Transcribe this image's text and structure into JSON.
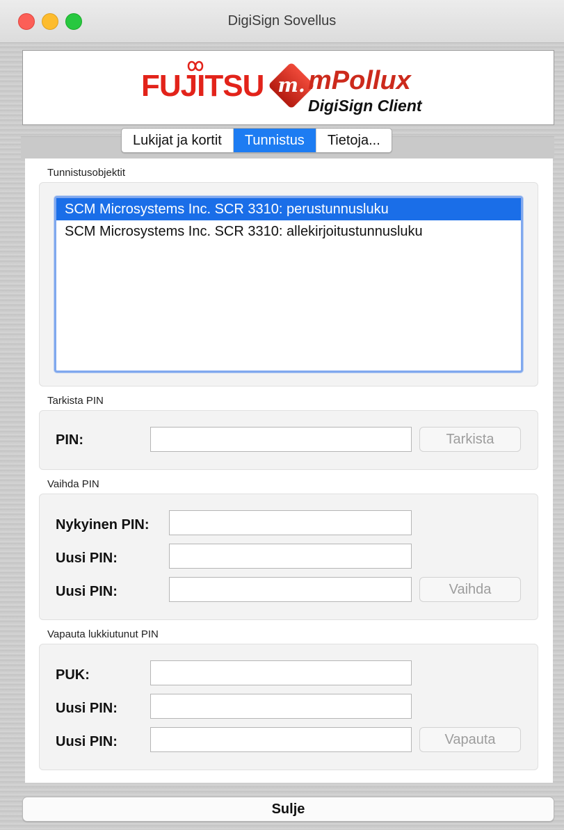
{
  "window": {
    "title": "DigiSign Sovellus"
  },
  "banner": {
    "brand": "FUJITSU",
    "product": "mPollux",
    "subtitle": "DigiSign Client",
    "logo_letter": "m."
  },
  "tabs": [
    {
      "label": "Lukijat ja kortit",
      "active": false
    },
    {
      "label": "Tunnistus",
      "active": true
    },
    {
      "label": "Tietoja...",
      "active": false
    }
  ],
  "auth_objects": {
    "label": "Tunnistusobjektit",
    "items": [
      {
        "text": "SCM Microsystems Inc. SCR 3310: perustunnusluku",
        "selected": true
      },
      {
        "text": "SCM Microsystems Inc. SCR 3310: allekirjoitustunnusluku",
        "selected": false
      }
    ]
  },
  "check_pin": {
    "label": "Tarkista PIN",
    "pin_label": "PIN:",
    "pin_value": "",
    "button": "Tarkista"
  },
  "change_pin": {
    "label": "Vaihda PIN",
    "current_label": "Nykyinen PIN:",
    "current_value": "",
    "new_label": "Uusi PIN:",
    "new_value": "",
    "confirm_label": "Uusi PIN:",
    "confirm_value": "",
    "button": "Vaihda"
  },
  "unblock_pin": {
    "label": "Vapauta lukkiutunut PIN",
    "puk_label": "PUK:",
    "puk_value": "",
    "new_label": "Uusi PIN:",
    "new_value": "",
    "confirm_label": "Uusi PIN:",
    "confirm_value": "",
    "button": "Vapauta"
  },
  "footer": {
    "close_button": "Sulje"
  },
  "colors": {
    "accent": "#1d7cf2",
    "selection": "#1a6ee8",
    "brand_red": "#e2231a"
  }
}
